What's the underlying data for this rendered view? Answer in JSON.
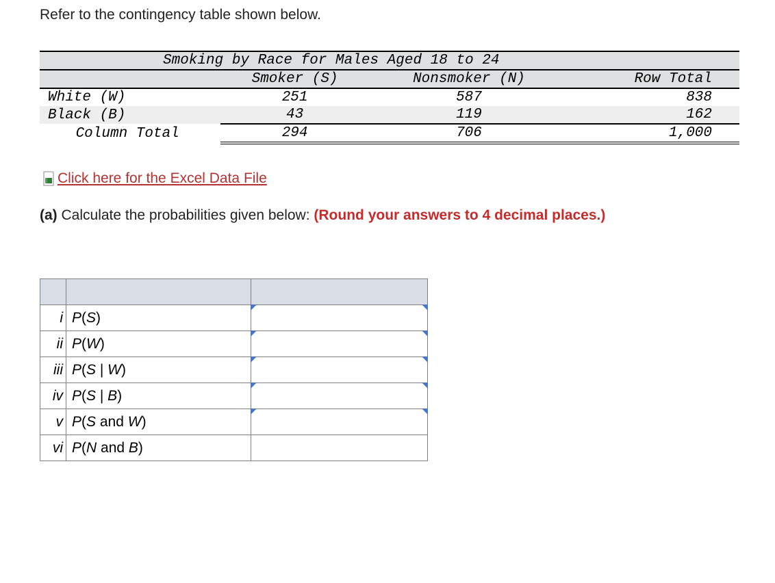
{
  "intro": "Refer to the contingency table shown below.",
  "table": {
    "title": "Smoking by Race for Males Aged 18 to 24",
    "col_headers": {
      "c1": "Smoker (S)",
      "c2": "Nonsmoker (N)",
      "c3": "Row Total"
    },
    "rows": [
      {
        "label": "White (W)",
        "c1": "251",
        "c2": "587",
        "c3": "838"
      },
      {
        "label": "Black (B)",
        "c1": "43",
        "c2": "119",
        "c3": "162"
      }
    ],
    "col_total": {
      "label": "Column Total",
      "c1": "294",
      "c2": "706",
      "c3": "1,000"
    }
  },
  "excel_link": {
    "label": " Click here for the Excel Data File"
  },
  "part_a": {
    "prefix": "(a)",
    "text": " Calculate the probabilities given below: ",
    "red": "(Round your answers to 4 decimal places.)"
  },
  "answers": [
    {
      "num": "i",
      "p": "P",
      "open": "(",
      "inner1": "S",
      "mid": "",
      "inner2": "",
      "close": ")"
    },
    {
      "num": "ii",
      "p": "P",
      "open": "(",
      "inner1": "W",
      "mid": "",
      "inner2": "",
      "close": ")"
    },
    {
      "num": "iii",
      "p": "P",
      "open": "(",
      "inner1": "S",
      "mid": " | ",
      "inner2": "W",
      "close": ")"
    },
    {
      "num": "iv",
      "p": "P",
      "open": "(",
      "inner1": "S",
      "mid": " | ",
      "inner2": "B",
      "close": ")"
    },
    {
      "num": "v",
      "p": "P",
      "open": "(",
      "inner1": "S",
      "mid": " and ",
      "inner2": "W",
      "close": ")"
    },
    {
      "num": "vi",
      "p": "P",
      "open": "(",
      "inner1": "N",
      "mid": " and ",
      "inner2": "B",
      "close": ")"
    }
  ]
}
